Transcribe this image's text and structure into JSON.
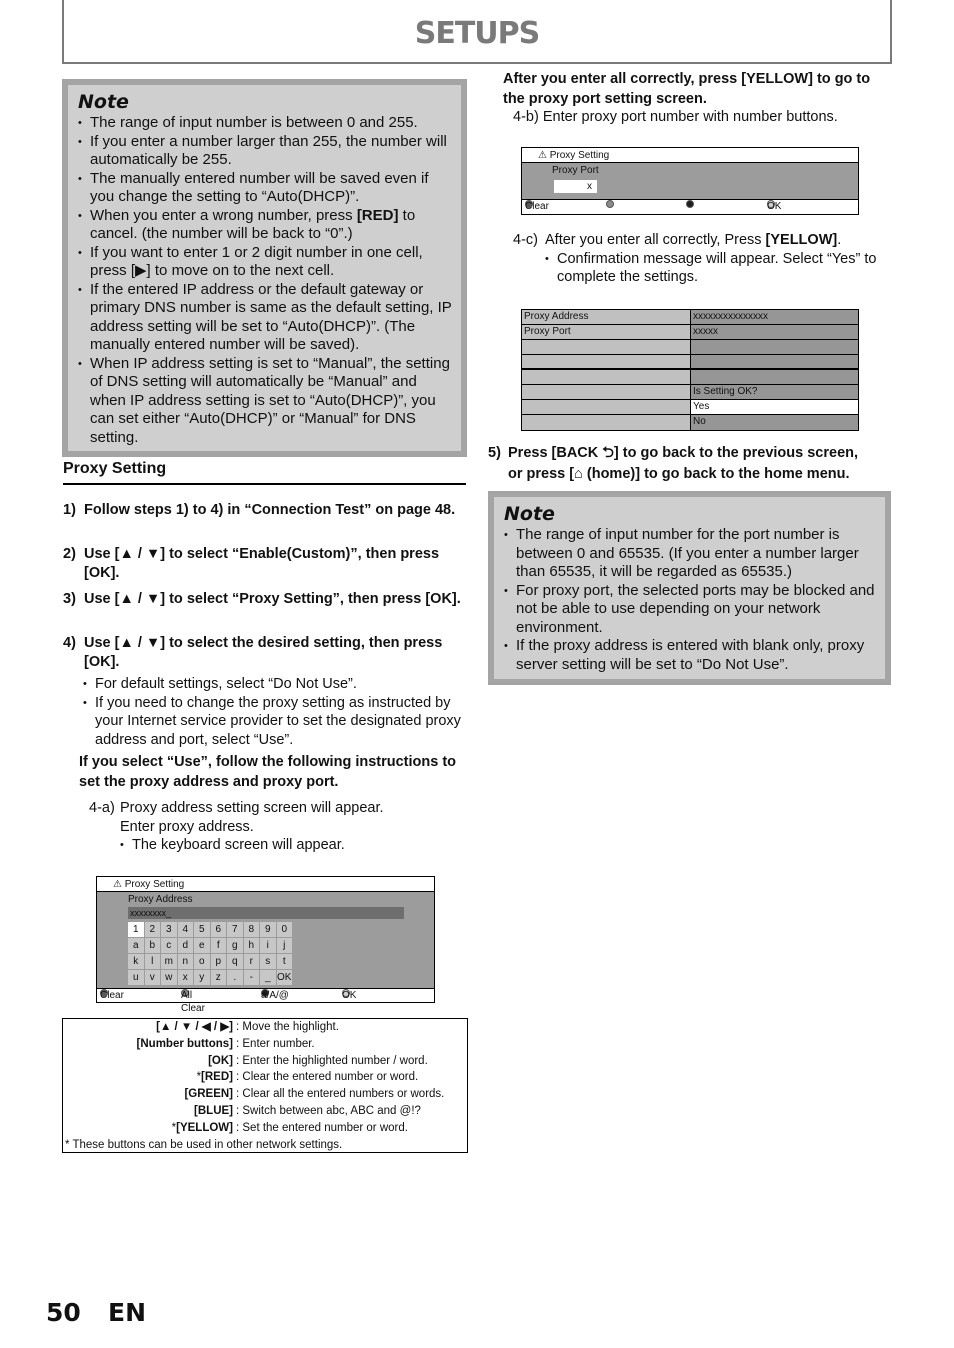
{
  "header": {
    "title": "SETUPS"
  },
  "note1": {
    "title": "Note",
    "bullets": [
      "The range of input number is between 0 and 255.",
      "If you enter a number larger than 255, the number will automatically be 255.",
      "The manually entered number will be saved even if you change the setting to “Auto(DHCP)”.",
      {
        "pre": "When you enter a wrong number, press ",
        "bold": "[RED]",
        "post": " to cancel. (the number will be back to “0”.)"
      },
      "If you want to enter 1 or 2 digit number in one cell, press [▶] to move on to the next cell.",
      "If the entered IP address or the default gateway or primary DNS number is same as the default setting, IP address setting will be set to “Auto(DHCP)”. (The manually entered number will be saved).",
      "When IP address setting is set to “Manual”, the setting of DNS setting will automatically be “Manual” and when IP address setting is set to “Auto(DHCP)”, you can set either “Auto(DHCP)” or “Manual” for DNS setting."
    ]
  },
  "section": {
    "title": "Proxy Setting"
  },
  "steps": [
    {
      "num": "1)",
      "text": "Follow steps 1) to 4) in “Connection Test” on page 48."
    },
    {
      "num": "2)",
      "text": "Use [▲ / ▼] to select “Enable(Custom)”, then press [OK]."
    },
    {
      "num": "3)",
      "text": "Use [▲ / ▼] to select “Proxy Setting”, then press [OK]."
    },
    {
      "num": "4)",
      "text": "Use [▲ / ▼] to select the desired setting, then press [OK]."
    }
  ],
  "step4_bullets": [
    "For default settings, select “Do Not Use”.",
    "If you need to change the proxy setting as instructed by your Internet service provider to set the designated proxy address and port, select “Use”."
  ],
  "use_instruction": "If you select “Use”, follow the following instructions to set the proxy address and proxy port.",
  "step4a": {
    "label": "4-a)",
    "line1": "Proxy address setting screen will appear.",
    "line2": "Enter proxy address.",
    "bullet": "The keyboard screen will appear."
  },
  "screen_address": {
    "title": "Proxy Setting",
    "field_label": "Proxy Address",
    "field_value": "xxxxxxxx_",
    "keys": [
      [
        "1",
        "2",
        "3",
        "4",
        "5",
        "6",
        "7",
        "8",
        "9",
        "0"
      ],
      [
        "a",
        "b",
        "c",
        "d",
        "e",
        "f",
        "g",
        "h",
        "i",
        "j"
      ],
      [
        "k",
        "l",
        "m",
        "n",
        "o",
        "p",
        "q",
        "r",
        "s",
        "t"
      ],
      [
        "u",
        "v",
        "w",
        "x",
        "y",
        "z",
        ".",
        "-",
        "_",
        "OK"
      ]
    ],
    "selected_key": "1",
    "footer": [
      {
        "label": "Clear",
        "color": "#5a5a5a"
      },
      {
        "label": "All Clear",
        "color": "#8a8a8a"
      },
      {
        "label": "a/A/@",
        "color": "#1e1e1e"
      },
      {
        "label": "OK",
        "color": "#d0d0d0"
      }
    ]
  },
  "legend": {
    "rows": [
      {
        "key": "[▲ / ▼ / ◀ / ▶]",
        "value": ": Move the highlight."
      },
      {
        "key": "[Number buttons]",
        "value": ": Enter number."
      },
      {
        "key": "[OK]",
        "value": ": Enter the highlighted number / word."
      },
      {
        "key": "[RED]",
        "star": "*",
        "value": ": Clear the entered number or word."
      },
      {
        "key": "[GREEN]",
        "value": ": Clear all the entered numbers or words."
      },
      {
        "key": "[BLUE]",
        "value": ": Switch between abc, ABC and @!?"
      },
      {
        "key": "[YELLOW]",
        "star": "*",
        "value": ": Set the entered number or word."
      }
    ],
    "footnote": "* These buttons can be used in other network settings."
  },
  "after_address": "After you enter all correctly, press [YELLOW] to go to the proxy port setting screen.",
  "step4b": {
    "label": "4-b)",
    "text": "Enter proxy port number with number buttons."
  },
  "screen_port": {
    "title": "Proxy Setting",
    "field_label": "Proxy Port",
    "field_value": "x",
    "footer": [
      {
        "label": "Clear",
        "color": "#5a5a5a"
      },
      {
        "label": "",
        "color": "#8a8a8a"
      },
      {
        "label": "",
        "color": "#1e1e1e"
      },
      {
        "label": "OK",
        "color": "#d0d0d0"
      }
    ]
  },
  "step4c": {
    "label": "4-c)",
    "pre": "After you enter all correctly, Press ",
    "bold": "[YELLOW]",
    "post": ".",
    "bullet": "Confirmation message will appear. Select “Yes” to complete the settings."
  },
  "confirm_screen": {
    "rows": [
      {
        "left": "Proxy Address",
        "right": "xxxxxxxxxxxxxxx"
      },
      {
        "left": "Proxy Port",
        "right": "xxxxx"
      },
      {
        "left": "",
        "right": ""
      },
      {
        "left": "",
        "right": ""
      },
      {
        "left": "",
        "right": ""
      },
      {
        "left": "",
        "right": "Is Setting OK?"
      },
      {
        "left": "",
        "right": "Yes"
      },
      {
        "left": "",
        "right": " No"
      }
    ],
    "selected": "Yes"
  },
  "step5": {
    "num": "5)",
    "line1": "Press [BACK ⮌] to go back to the previous screen,",
    "line2_pre": "or press [",
    "home_icon": "⌂",
    "line2_post": " (home)] to go back to the home menu."
  },
  "note2": {
    "title": "Note",
    "bullets": [
      "The range of input number for the port number is between 0 and 65535.  (If you enter a number larger than 65535, it will be regarded as 65535.)",
      "For proxy port, the selected ports may be blocked and not be able to use depending on  your network environment.",
      "If the proxy address is entered with blank only, proxy server setting will be set to “Do Not Use”."
    ]
  },
  "footer": {
    "page_number": "50",
    "language": "EN"
  }
}
